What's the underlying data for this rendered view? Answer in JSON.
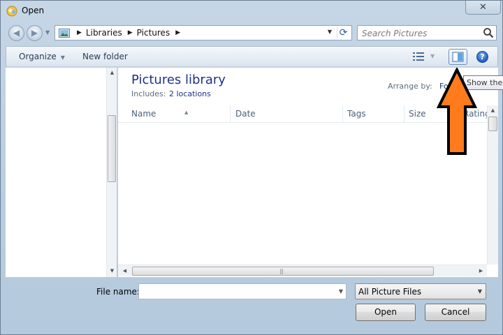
{
  "window": {
    "title": "Open",
    "close_symbol": "✕"
  },
  "address": {
    "crumbs": [
      "Libraries",
      "Pictures"
    ],
    "search_placeholder": "Search Pictures"
  },
  "toolbar": {
    "organize": "Organize",
    "new_folder": "New folder",
    "help_symbol": "?"
  },
  "tooltip": {
    "text": "Show the p"
  },
  "library": {
    "title": "Pictures library",
    "includes_label": "Includes:",
    "includes_value": "2 locations",
    "arrange_label": "Arrange by:",
    "arrange_value": "Fo"
  },
  "columns": [
    "Name",
    "Date",
    "Tags",
    "Size",
    "Rating"
  ],
  "bottom": {
    "filename_label": "File name:",
    "filename_value": "",
    "filetype_value": "All Picture Files",
    "open_label": "Open",
    "cancel_label": "Cancel"
  },
  "colors": {
    "annotation_arrow": "#ff7b1c",
    "library_title": "#1e3287"
  }
}
